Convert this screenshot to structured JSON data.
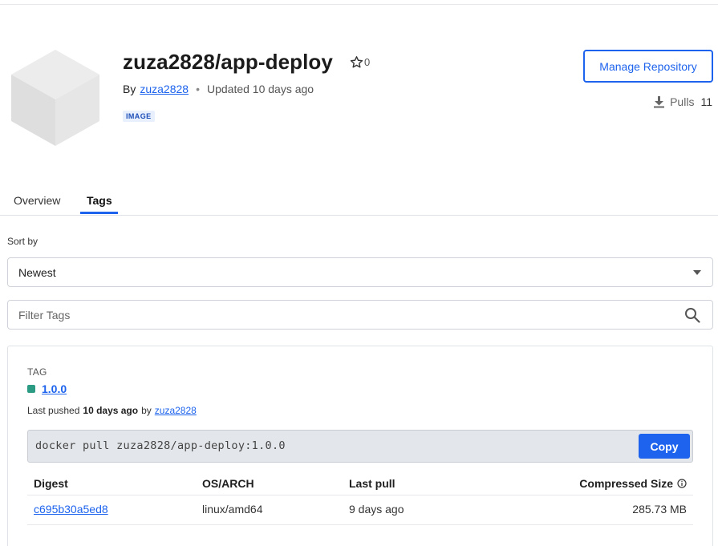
{
  "repo": {
    "title": "zuza2828/app-deploy",
    "stars": "0",
    "by_label": "By",
    "owner": "zuza2828",
    "updated": "Updated 10 days ago",
    "badge": "IMAGE",
    "manage_label": "Manage Repository",
    "pulls_label": "Pulls",
    "pulls_count": "11"
  },
  "tabs": [
    {
      "label": "Overview"
    },
    {
      "label": "Tags"
    }
  ],
  "sort": {
    "label": "Sort by",
    "selected": "Newest"
  },
  "filter": {
    "placeholder": "Filter Tags"
  },
  "tag": {
    "section_label": "TAG",
    "name": "1.0.0",
    "pushed_prefix": "Last pushed",
    "pushed_when": "10 days ago",
    "pushed_by_label": "by",
    "pushed_by": "zuza2828",
    "command": "docker pull zuza2828/app-deploy:1.0.0",
    "copy_label": "Copy",
    "dot_color": "#2b9b84"
  },
  "table": {
    "headers": [
      "Digest",
      "OS/ARCH",
      "Last pull",
      "Compressed Size"
    ],
    "rows": [
      {
        "digest": "c695b30a5ed8",
        "os_arch": "linux/amd64",
        "last_pull": "9 days ago",
        "size": "285.73 MB"
      }
    ]
  },
  "colors": {
    "accent": "#1d63ed",
    "tag_dot": "#2b9b84"
  }
}
